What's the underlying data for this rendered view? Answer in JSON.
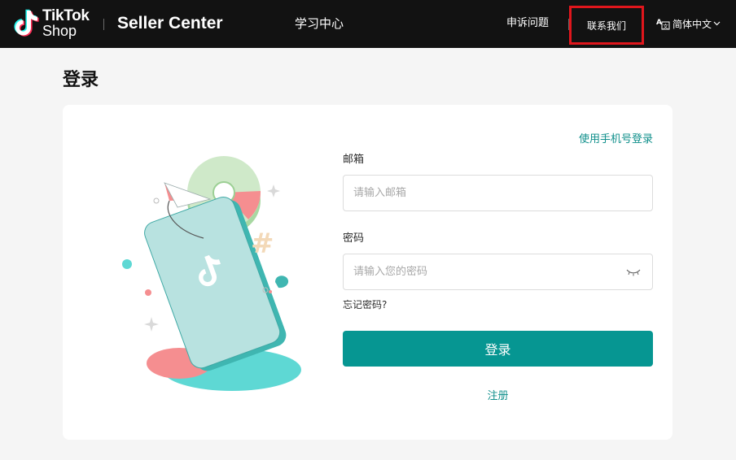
{
  "header": {
    "brand_top": "TikTok",
    "brand_bottom": "Shop",
    "product": "Seller Center",
    "nav_learning": "学习中心",
    "nav_appeal": "申诉问题",
    "nav_contact": "联系我们",
    "language": "简体中文"
  },
  "page": {
    "title": "登录"
  },
  "form": {
    "phone_login_link": "使用手机号登录",
    "email_label": "邮箱",
    "email_placeholder": "请输入邮箱",
    "password_label": "密码",
    "password_placeholder": "请输入您的密码",
    "forgot_password": "忘记密码?",
    "login_button": "登录",
    "register_link": "注册"
  },
  "colors": {
    "accent": "#069692",
    "link": "#0f8f8b",
    "header_bg": "#121212",
    "highlight_border": "#e0161c"
  },
  "icons": [
    "tiktok-logo-icon",
    "translate-icon",
    "chevron-down-icon",
    "eye-closed-icon",
    "login-illustration"
  ]
}
